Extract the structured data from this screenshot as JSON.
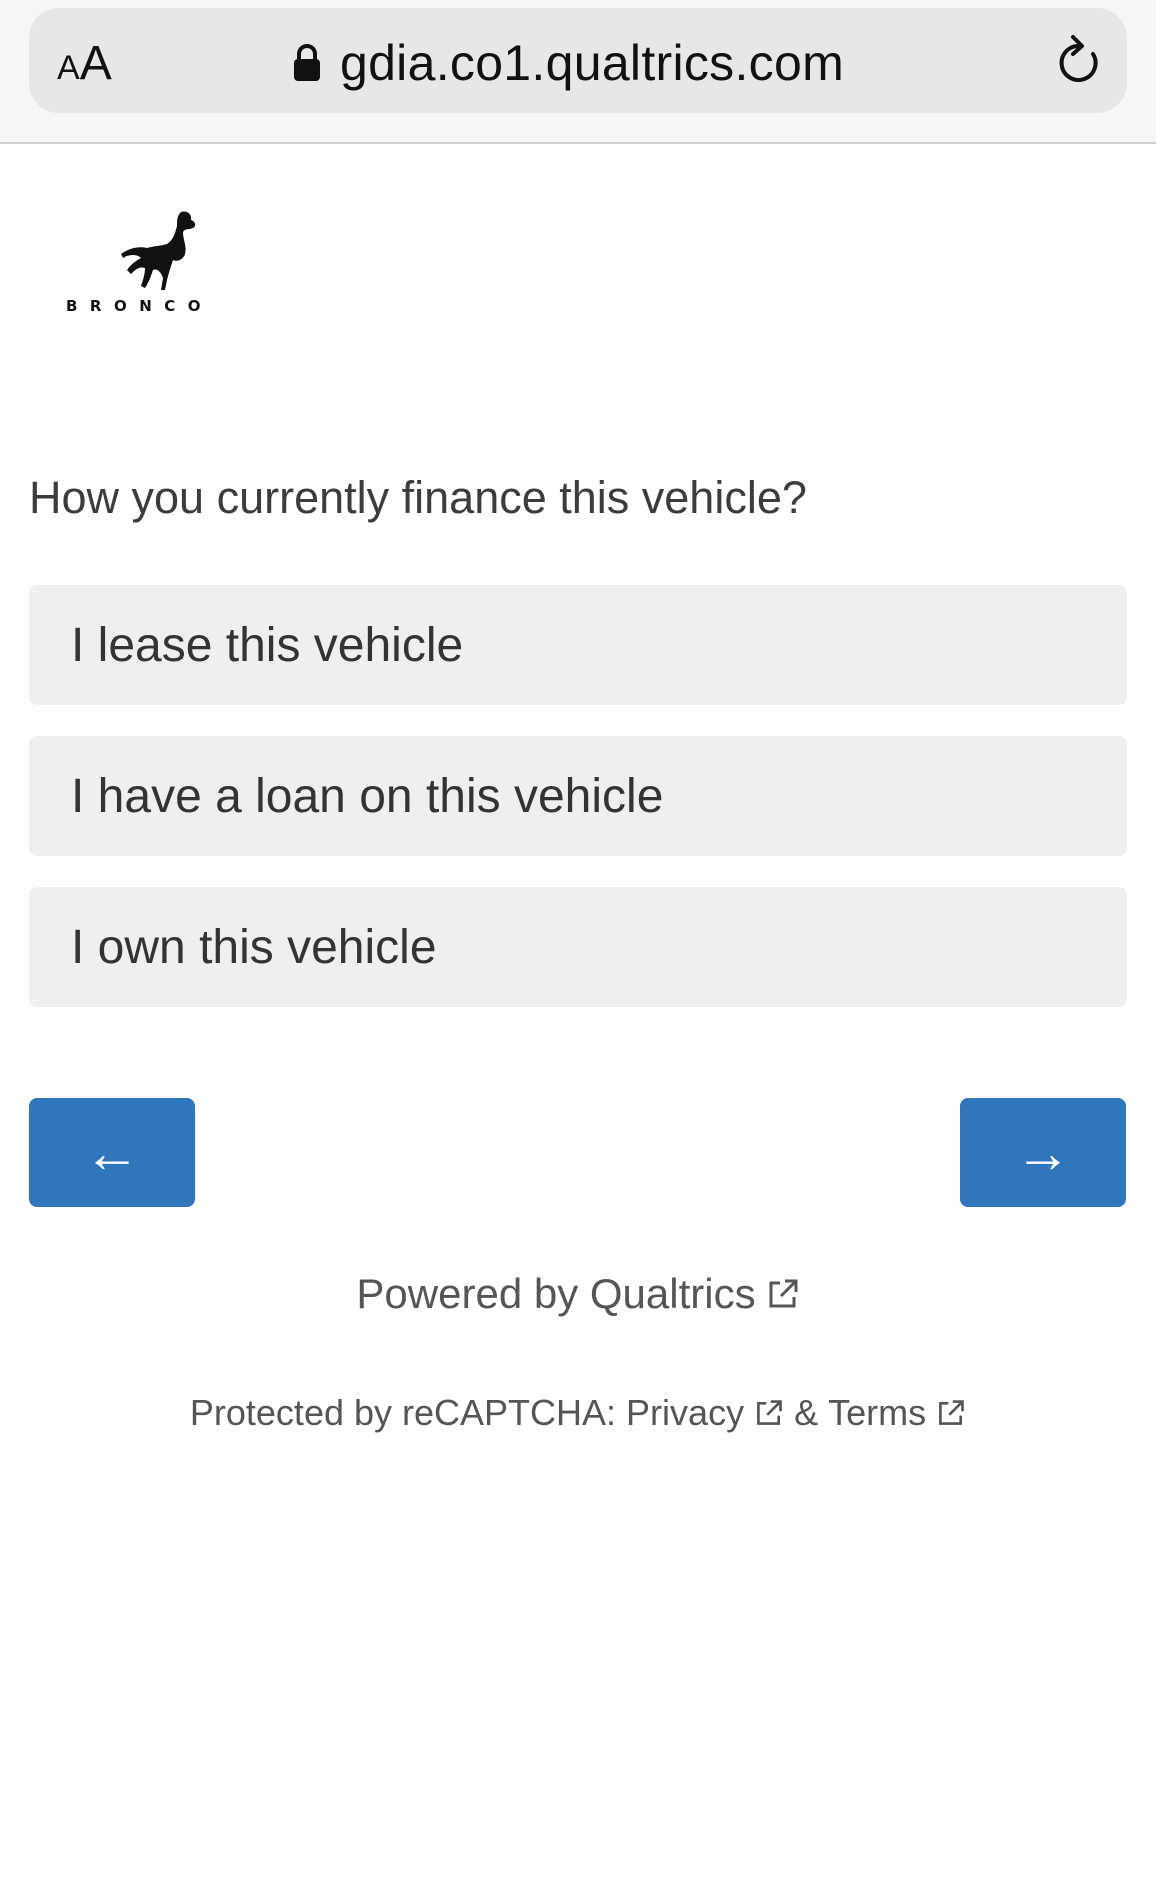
{
  "browser": {
    "text_size_small": "A",
    "text_size_big": "A",
    "url": "gdia.co1.qualtrics.com"
  },
  "logo": {
    "wordmark": "BRONCO"
  },
  "survey": {
    "question": "How you currently finance this vehicle?",
    "choices": [
      "I lease this vehicle",
      "I have a loan on this vehicle",
      "I own this vehicle"
    ],
    "prev_label": "←",
    "next_label": "→"
  },
  "footer": {
    "powered_by": "Powered by Qualtrics",
    "recaptcha_prefix": "Protected by reCAPTCHA:",
    "privacy": "Privacy",
    "amp": "&",
    "terms": "Terms"
  },
  "colors": {
    "accent": "#2f76bd",
    "choice_bg": "#efefef"
  }
}
